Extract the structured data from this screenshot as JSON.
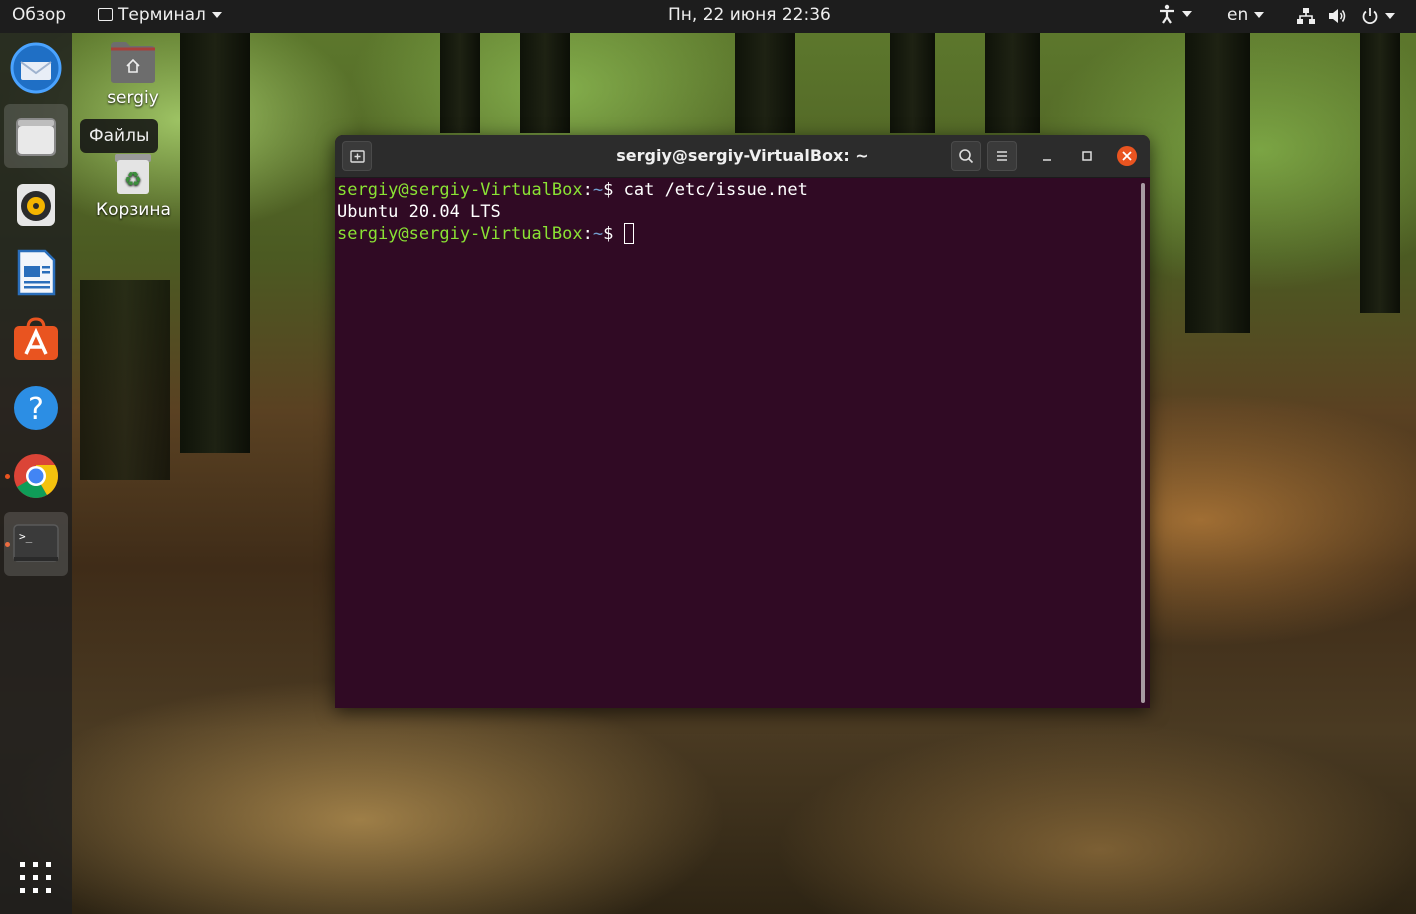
{
  "topbar": {
    "overview": "Обзор",
    "app_menu": "Терминал",
    "clock": "Пн, 22 июня  22:36",
    "language": "en"
  },
  "dock": {
    "items": [
      {
        "name": "thunderbird",
        "icon": "mail-icon"
      },
      {
        "name": "files",
        "icon": "folder-icon",
        "tooltip": "Файлы"
      },
      {
        "name": "rhythmbox",
        "icon": "music-icon"
      },
      {
        "name": "writer",
        "icon": "document-icon"
      },
      {
        "name": "software",
        "icon": "store-icon"
      },
      {
        "name": "help",
        "icon": "help-icon",
        "glyph": "?"
      },
      {
        "name": "chrome",
        "icon": "chrome-icon"
      },
      {
        "name": "terminal",
        "icon": "terminal-icon",
        "glyph": ">_"
      }
    ],
    "apps_grid": "apps-grid-icon"
  },
  "desktop": {
    "home_label": "sergiy",
    "trash_label": "Корзина"
  },
  "terminal": {
    "title": "sergiy@sergiy-VirtualBox: ~",
    "lines": [
      {
        "user": "sergiy@sergiy-VirtualBox",
        "sep": ":",
        "path": "~",
        "dollar": "$ ",
        "cmd": "cat /etc/issue.net"
      },
      {
        "output": "Ubuntu 20.04 LTS"
      },
      {
        "user": "sergiy@sergiy-VirtualBox",
        "sep": ":",
        "path": "~",
        "dollar": "$ ",
        "cmd": ""
      }
    ]
  },
  "colors": {
    "terminal_bg": "#300a24",
    "prompt_user": "#8ae234",
    "prompt_path": "#729fcf",
    "accent": "#e95420",
    "close_button": "#e95420"
  }
}
